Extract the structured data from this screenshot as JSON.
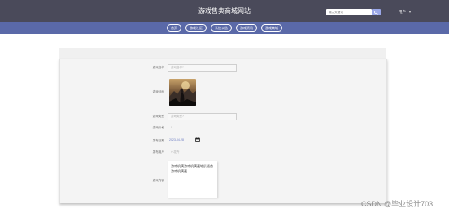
{
  "header": {
    "site_title": "游戏售卖商城网站",
    "search_placeholder": "输入关键词",
    "user_name": "用户"
  },
  "nav": {
    "items": [
      "首页",
      "游戏社区",
      "系统公告",
      "游戏资讯",
      "游戏商城"
    ]
  },
  "form": {
    "game_name": {
      "label": "游戏名称",
      "placeholder": "游戏名称?"
    },
    "cover": {
      "label": "游戏封面"
    },
    "game_type": {
      "label": "游戏类型",
      "placeholder": "游戏类型?"
    },
    "sales": {
      "label": "游戏价格",
      "value": "0"
    },
    "date": {
      "label": "发布日期",
      "value": "2023-04-28"
    },
    "user": {
      "label": "发布用户",
      "value": "小花卉"
    },
    "content": {
      "label": "游戏内容",
      "value": "游戏机满游戏机满速地反插首游戏机满速"
    }
  },
  "watermark": "CSDN @毕业设计703",
  "colors": {
    "topbar": "#4a4a5a",
    "navbar": "#5a69a8",
    "accent": "#9aa7e8",
    "card": "#f4f4f4"
  },
  "icons": [
    "search-icon",
    "chevron-down-icon",
    "calendar-icon"
  ]
}
